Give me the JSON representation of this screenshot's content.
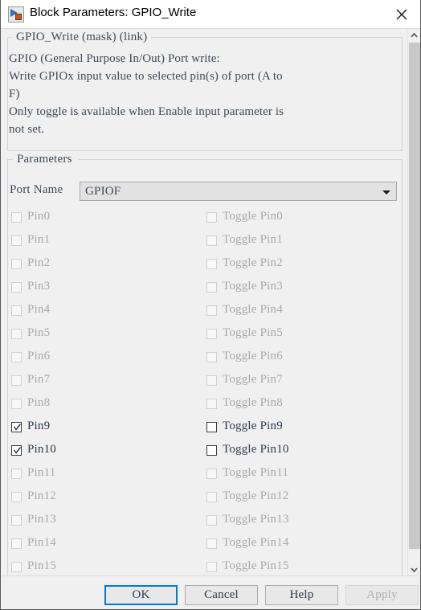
{
  "window": {
    "title": "Block Parameters: GPIO_Write",
    "icon": "simulink-block-icon",
    "close_icon": "close-icon"
  },
  "description": {
    "legend": "GPIO_Write (mask) (link)",
    "body": "GPIO (General Purpose In/Out) Port write:\nWrite GPIOx input value to selected pin(s) of port (A to\nF)\nOnly toggle is available when Enable input parameter is\nnot set."
  },
  "parameters": {
    "legend": "Parameters",
    "port_name": {
      "label": "Port Name",
      "value": "GPIOF",
      "arrow_icon": "chevron-down-icon"
    },
    "pins": [
      {
        "pin_label": "Pin0",
        "pin_checked": false,
        "pin_enabled": false,
        "toggle_label": "Toggle Pin0",
        "toggle_checked": false,
        "toggle_enabled": false
      },
      {
        "pin_label": "Pin1",
        "pin_checked": false,
        "pin_enabled": false,
        "toggle_label": "Toggle Pin1",
        "toggle_checked": false,
        "toggle_enabled": false
      },
      {
        "pin_label": "Pin2",
        "pin_checked": false,
        "pin_enabled": false,
        "toggle_label": "Toggle Pin2",
        "toggle_checked": false,
        "toggle_enabled": false
      },
      {
        "pin_label": "Pin3",
        "pin_checked": false,
        "pin_enabled": false,
        "toggle_label": "Toggle Pin3",
        "toggle_checked": false,
        "toggle_enabled": false
      },
      {
        "pin_label": "Pin4",
        "pin_checked": false,
        "pin_enabled": false,
        "toggle_label": "Toggle Pin4",
        "toggle_checked": false,
        "toggle_enabled": false
      },
      {
        "pin_label": "Pin5",
        "pin_checked": false,
        "pin_enabled": false,
        "toggle_label": "Toggle Pin5",
        "toggle_checked": false,
        "toggle_enabled": false
      },
      {
        "pin_label": "Pin6",
        "pin_checked": false,
        "pin_enabled": false,
        "toggle_label": "Toggle Pin6",
        "toggle_checked": false,
        "toggle_enabled": false
      },
      {
        "pin_label": "Pin7",
        "pin_checked": false,
        "pin_enabled": false,
        "toggle_label": "Toggle Pin7",
        "toggle_checked": false,
        "toggle_enabled": false
      },
      {
        "pin_label": "Pin8",
        "pin_checked": false,
        "pin_enabled": false,
        "toggle_label": "Toggle Pin8",
        "toggle_checked": false,
        "toggle_enabled": false
      },
      {
        "pin_label": "Pin9",
        "pin_checked": true,
        "pin_enabled": true,
        "toggle_label": "Toggle Pin9",
        "toggle_checked": false,
        "toggle_enabled": true
      },
      {
        "pin_label": "Pin10",
        "pin_checked": true,
        "pin_enabled": true,
        "toggle_label": "Toggle Pin10",
        "toggle_checked": false,
        "toggle_enabled": true
      },
      {
        "pin_label": "Pin11",
        "pin_checked": false,
        "pin_enabled": false,
        "toggle_label": "Toggle Pin11",
        "toggle_checked": false,
        "toggle_enabled": false
      },
      {
        "pin_label": "Pin12",
        "pin_checked": false,
        "pin_enabled": false,
        "toggle_label": "Toggle Pin12",
        "toggle_checked": false,
        "toggle_enabled": false
      },
      {
        "pin_label": "Pin13",
        "pin_checked": false,
        "pin_enabled": false,
        "toggle_label": "Toggle Pin13",
        "toggle_checked": false,
        "toggle_enabled": false
      },
      {
        "pin_label": "Pin14",
        "pin_checked": false,
        "pin_enabled": false,
        "toggle_label": "Toggle Pin14",
        "toggle_checked": false,
        "toggle_enabled": false
      },
      {
        "pin_label": "Pin15",
        "pin_checked": false,
        "pin_enabled": false,
        "toggle_label": "Toggle Pin15",
        "toggle_checked": false,
        "toggle_enabled": false
      }
    ]
  },
  "scrollbar": {
    "up_icon": "chevron-up-icon",
    "down_icon": "chevron-down-icon"
  },
  "buttons": {
    "ok": "OK",
    "cancel": "Cancel",
    "help": "Help",
    "apply": "Apply",
    "apply_enabled": false,
    "focused": "ok"
  },
  "colors": {
    "dialog_bg": "#f0f0f0",
    "titlebar_bg": "#ffffff",
    "label_text": "#3d4a59",
    "disabled_text": "#a9a9a9",
    "focus_accent": "#0078d7",
    "scroll_thumb": "#c8c8c8"
  }
}
